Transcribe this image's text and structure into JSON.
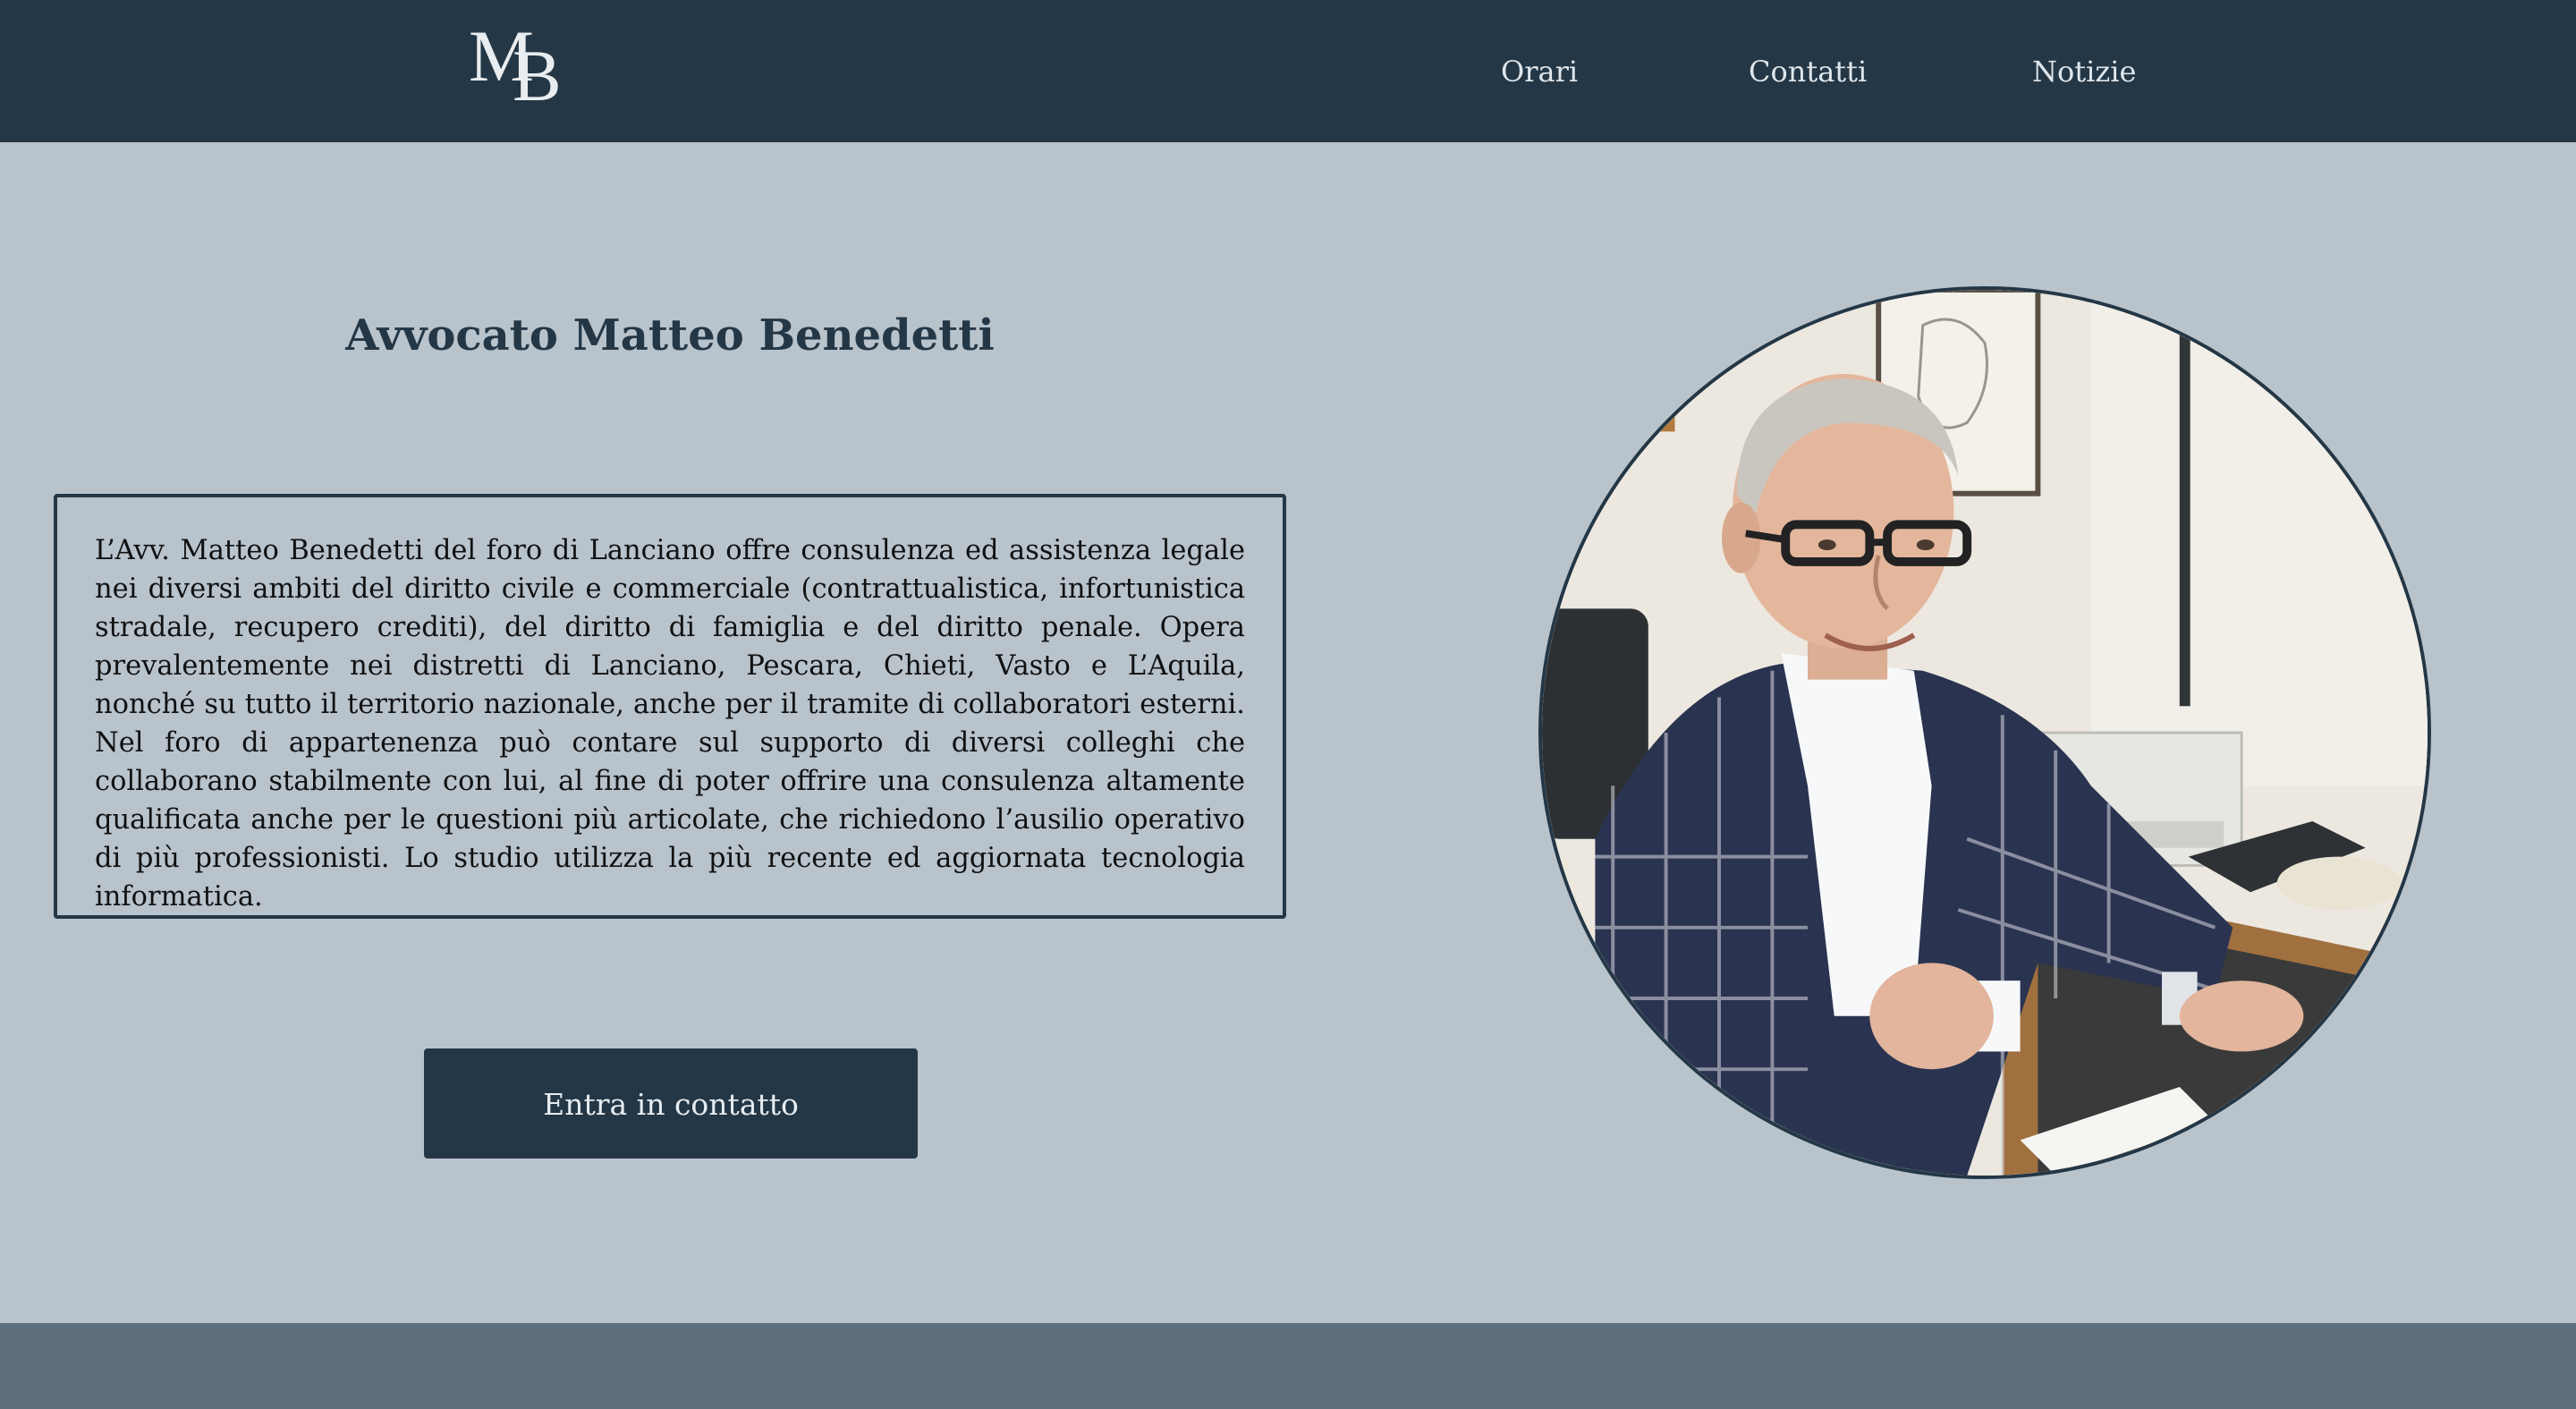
{
  "header": {
    "logo": "MB",
    "logo_letters": [
      "M",
      "B"
    ],
    "nav": [
      {
        "label": "Orari"
      },
      {
        "label": "Contatti"
      },
      {
        "label": "Notizie"
      }
    ]
  },
  "main": {
    "title": "Avvocato Matteo Benedetti",
    "bio": "L’Avv. Matteo Benedetti del foro di Lanciano offre consulenza ed assistenza legale nei diversi ambiti del diritto civile e commerciale (contrattualistica, infortunistica stradale, recupero crediti), del diritto di famiglia e del diritto penale. Opera prevalentemente nei distretti di Lanciano, Pescara, Chieti, Vasto e L’Aquila, nonché su tutto il territorio nazionale, anche per il tramite di collaboratori esterni. Nel foro di appartenenza può contare sul supporto di diversi colleghi che collaborano stabilmente con lui, al fine di poter offrire una consulenza altamente qualificata anche per le questioni più articolate, che richiedono l’ausilio operativo di più professionisti. Lo studio utilizza la più recente ed aggiornata tecnologia informatica.",
    "cta_label": "Entra in contatto"
  },
  "colors": {
    "header_bg": "#243746",
    "page_bg": "#b8c3cc",
    "footer_bg": "#5d6f7b",
    "accent": "#243746"
  }
}
